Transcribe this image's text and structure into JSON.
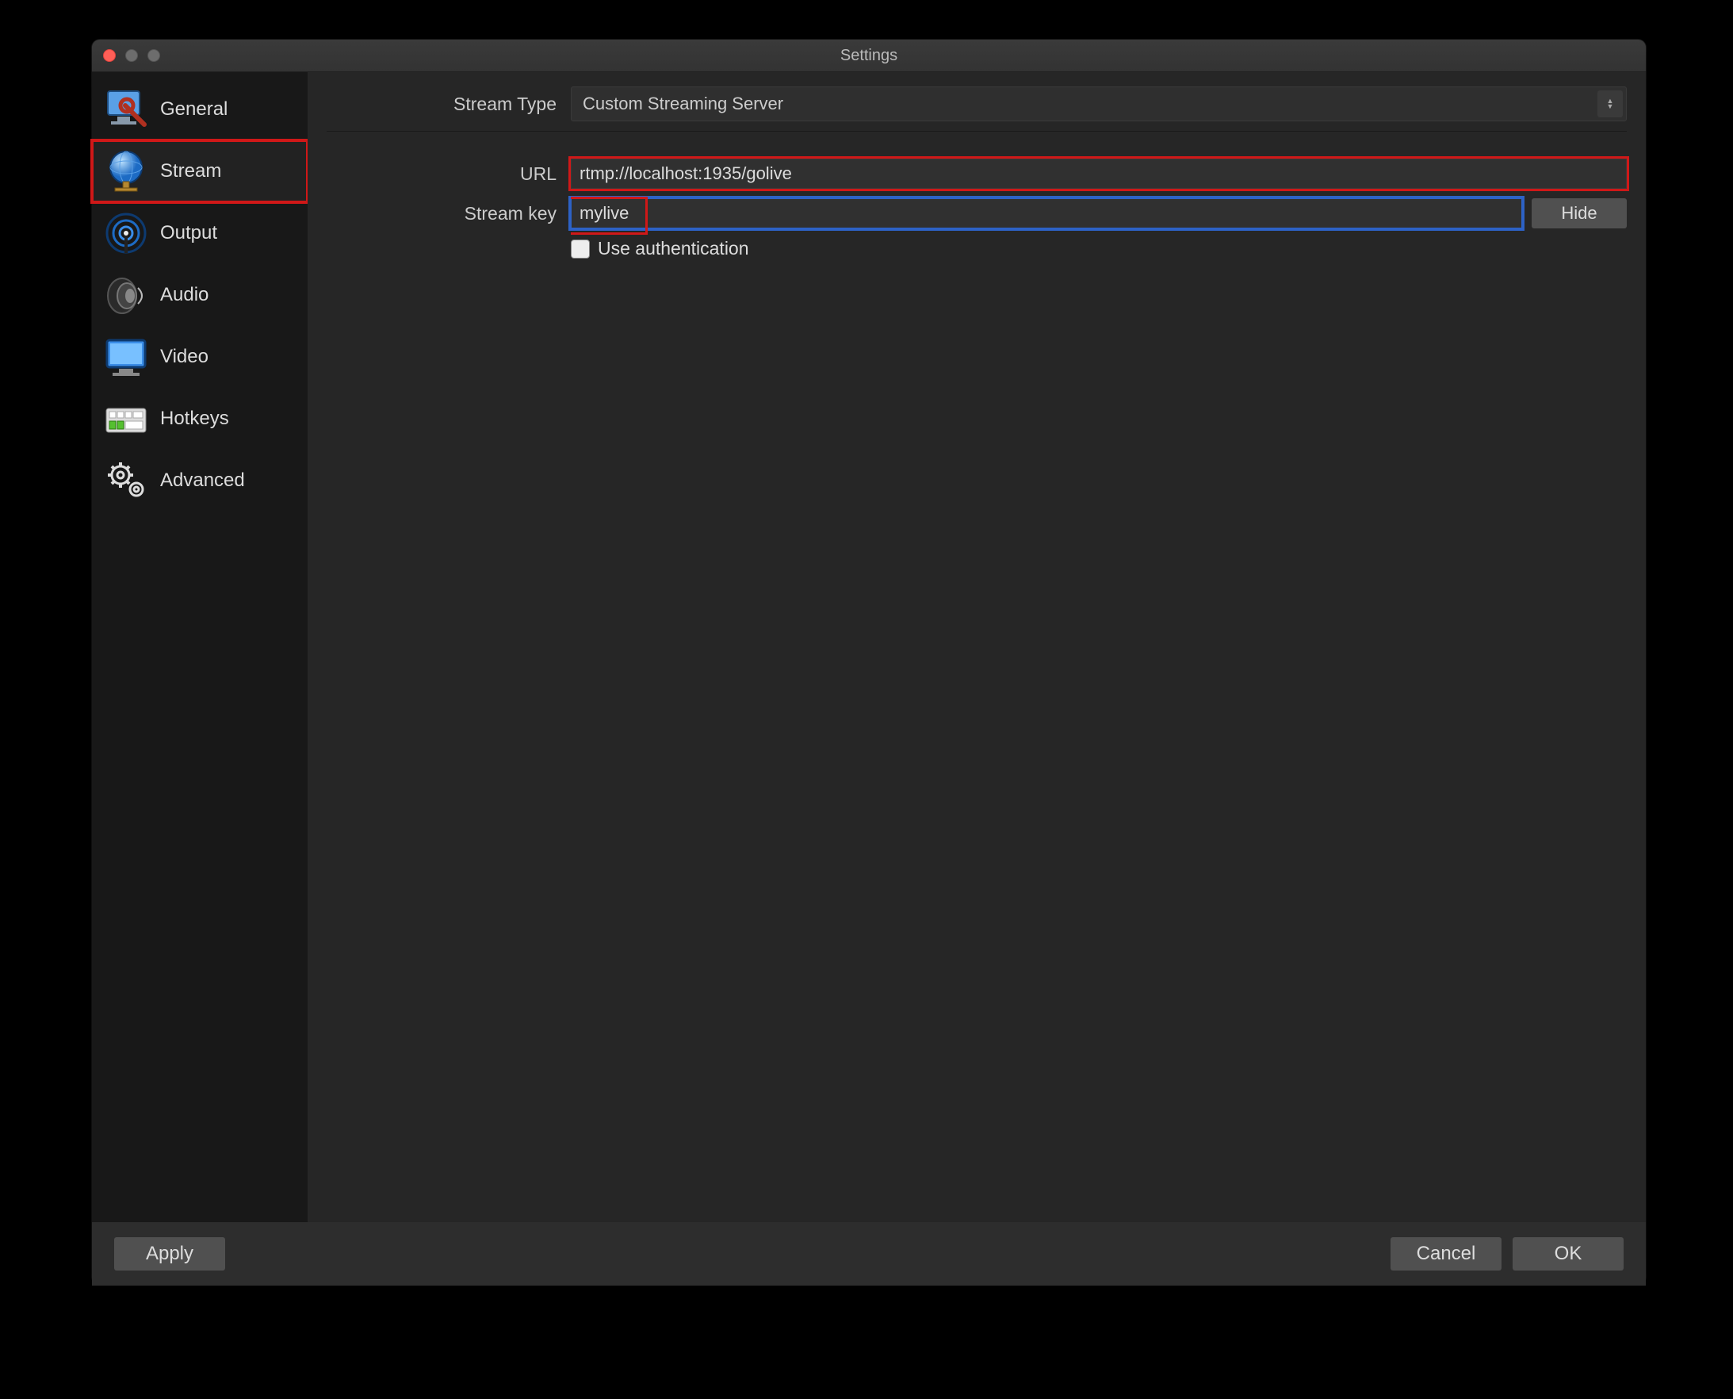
{
  "window": {
    "title": "Settings"
  },
  "sidebar": {
    "items": [
      {
        "label": "General",
        "icon": "monitor-wrench"
      },
      {
        "label": "Stream",
        "icon": "globe"
      },
      {
        "label": "Output",
        "icon": "broadcast-tower"
      },
      {
        "label": "Audio",
        "icon": "speaker"
      },
      {
        "label": "Video",
        "icon": "display"
      },
      {
        "label": "Hotkeys",
        "icon": "keyboard"
      },
      {
        "label": "Advanced",
        "icon": "gears"
      }
    ],
    "selected_index": 1
  },
  "form": {
    "stream_type_label": "Stream Type",
    "stream_type_value": "Custom Streaming Server",
    "url_label": "URL",
    "url_value": "rtmp://localhost:1935/golive",
    "stream_key_label": "Stream key",
    "stream_key_value": "mylive",
    "hide_button": "Hide",
    "use_auth_label": "Use authentication",
    "use_auth_checked": false
  },
  "footer": {
    "apply": "Apply",
    "cancel": "Cancel",
    "ok": "OK"
  },
  "highlights": {
    "stream_sidebar": "red",
    "url_field": "red",
    "stream_key_field": "blue+red-partial"
  }
}
